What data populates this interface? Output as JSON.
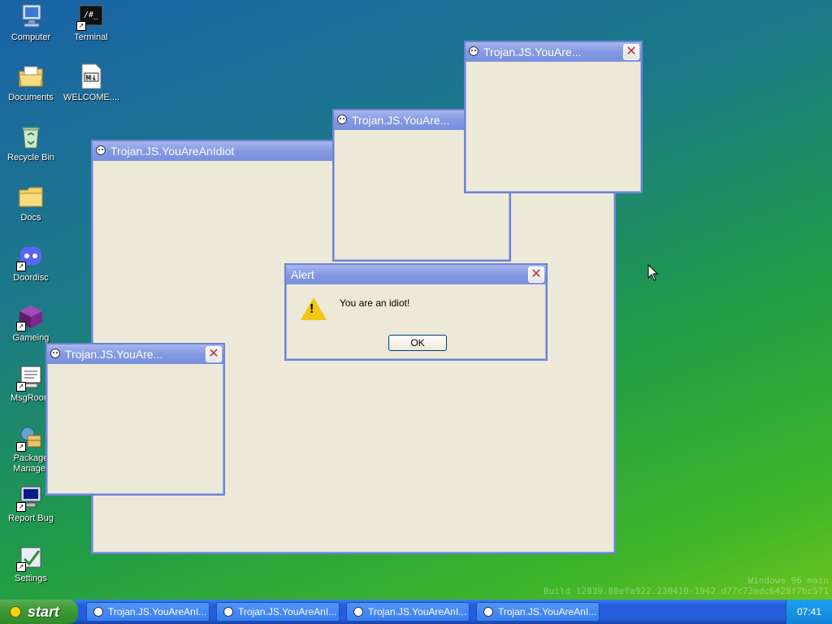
{
  "desktop": {
    "icons": [
      {
        "label": "Computer",
        "icon": "computer-icon"
      },
      {
        "label": "Terminal",
        "icon": "terminal-icon"
      },
      {
        "label": "Documents",
        "icon": "documents-folder-icon"
      },
      {
        "label": "WELCOME....",
        "icon": "markdown-file-icon"
      },
      {
        "label": "Recycle Bin",
        "icon": "recycle-bin-icon"
      },
      {
        "label": "Docs",
        "icon": "folder-icon"
      },
      {
        "label": "Doordisc",
        "icon": "discord-icon"
      },
      {
        "label": "Gameing",
        "icon": "cube-icon"
      },
      {
        "label": "MsgRoom",
        "icon": "msgroom-icon"
      },
      {
        "label": "Package Manager",
        "icon": "package-manager-icon"
      },
      {
        "label": "Report Bug",
        "icon": "report-bug-icon"
      },
      {
        "label": "Settings",
        "icon": "settings-icon"
      }
    ],
    "terminal_glyph": "/#_",
    "doc_glyph": "M↓"
  },
  "windows": {
    "big": {
      "title": "Trojan.JS.YouAreAnIdiot"
    },
    "mid": {
      "title": "Trojan.JS.YouAre..."
    },
    "top": {
      "title": "Trojan.JS.YouAre..."
    },
    "small": {
      "title": "Trojan.JS.YouAre..."
    },
    "close_glyph": "✕"
  },
  "alert": {
    "title": "Alert",
    "message": "You are an idiot!",
    "ok_label": "OK",
    "warning_mark": "!"
  },
  "watermark": {
    "line1": "Windows 96 main",
    "line2": "Build 12839.88efa922.230410-1942.d77c73edc6428f7bc571"
  },
  "taskbar": {
    "start_label": "start",
    "tasks": [
      {
        "label": "Trojan.JS.YouAreAnI..."
      },
      {
        "label": "Trojan.JS.YouAreAnI..."
      },
      {
        "label": "Trojan.JS.YouAreAnI..."
      },
      {
        "label": "Trojan.JS.YouAreAnI..."
      }
    ],
    "clock": "07:41"
  }
}
